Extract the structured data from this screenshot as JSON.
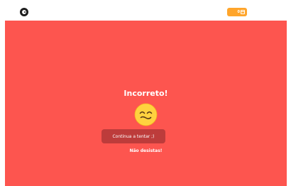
{
  "header": {
    "logo_icon": "app-logo-icon",
    "badge": {
      "count": "0",
      "icon": "crate-icon",
      "color": "#ffa52b"
    }
  },
  "feedback": {
    "title": "Incorreto!",
    "face_icon": "relieved-face-icon",
    "continue_label": "Continua a tentar ;)",
    "encouragement": "Não desistas!",
    "panel_color": "#fd554f"
  }
}
